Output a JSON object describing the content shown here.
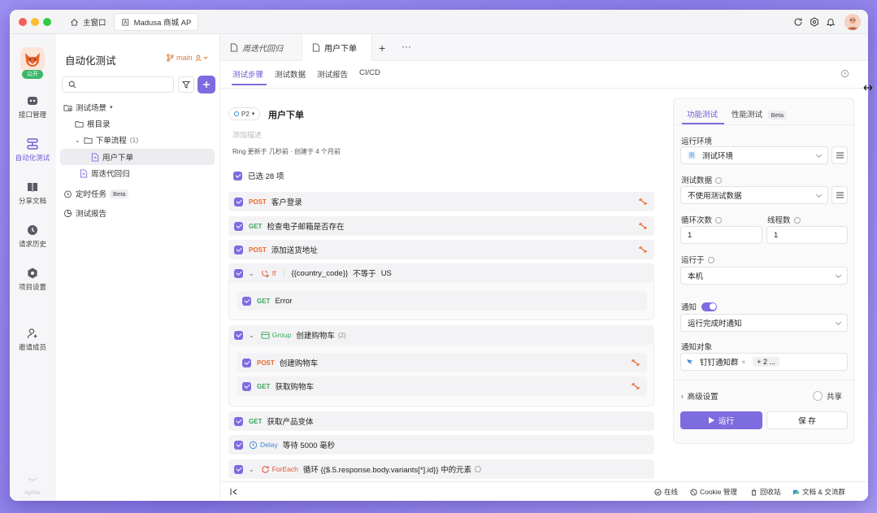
{
  "window": {
    "tabs": [
      {
        "label": "主窗口"
      },
      {
        "label": "Madusa 商城 API"
      }
    ]
  },
  "rail": {
    "team_badge": "公开",
    "items": [
      {
        "label": "接口管理",
        "icon": "api-icon"
      },
      {
        "label": "自动化测试",
        "icon": "automation-icon"
      },
      {
        "label": "分享文档",
        "icon": "book-icon"
      },
      {
        "label": "请求历史",
        "icon": "history-icon"
      },
      {
        "label": "项目设置",
        "icon": "settings-icon"
      },
      {
        "label": "邀请成员",
        "icon": "invite-user-icon"
      }
    ],
    "brand": "Apifox"
  },
  "tree": {
    "title": "自动化测试",
    "branch": "main",
    "search_placeholder": "",
    "rows": [
      {
        "label": "测试场景"
      },
      {
        "label": "根目录"
      },
      {
        "label": "下单流程",
        "count": "(1)"
      },
      {
        "label": "用户下单"
      },
      {
        "label": "周迭代回归"
      },
      {
        "label": "定时任务",
        "badge": "Beta"
      },
      {
        "label": "测试报告"
      }
    ]
  },
  "file_tabs": [
    {
      "label": "周迭代回归"
    },
    {
      "label": "用户下单"
    }
  ],
  "sub_tabs": [
    "测试步骤",
    "测试数据",
    "测试报告",
    "CI/CD"
  ],
  "scenario": {
    "priority": "P2",
    "name": "用户下单",
    "desc_placeholder": "添加描述",
    "meta": "Ring 更新于 几秒前 · 创建于 4 个月前",
    "selected_label": "已选 28 项"
  },
  "steps": [
    {
      "method": "POST",
      "name": "客户登录"
    },
    {
      "method": "GET",
      "name": "检查电子邮箱是否存在"
    },
    {
      "method": "POST",
      "name": "添加送货地址"
    },
    {
      "kind": "If",
      "left": "{{country_code}}",
      "op": "不等于",
      "right": "US"
    },
    {
      "method": "GET",
      "name": "Error"
    },
    {
      "kind": "Group",
      "name": "创建购物车",
      "count": "(2)"
    },
    {
      "method": "POST",
      "name": "创建购物车"
    },
    {
      "method": "GET",
      "name": "获取购物车"
    },
    {
      "method": "GET",
      "name": "获取产品变体"
    },
    {
      "kind": "Delay",
      "name": "等待 5000 毫秒"
    },
    {
      "kind": "ForEach",
      "name": "循环 {{$.5.response.body.variants[*].id}} 中的元素"
    }
  ],
  "panel": {
    "tabs": [
      "功能测试",
      "性能测试"
    ],
    "perf_badge": "Beta",
    "env_label": "运行环境",
    "env_value": "测试环境",
    "data_label": "测试数据",
    "data_value": "不使用测试数据",
    "loop_label": "循环次数",
    "loop_value": "1",
    "threads_label": "线程数",
    "threads_value": "1",
    "run_on_label": "运行于",
    "run_on_value": "本机",
    "notify_label": "通知",
    "notify_enabled": true,
    "notify_value": "运行完成时通知",
    "notify_target_label": "通知对象",
    "notify_target_tag": "钉钉通知群",
    "notify_more": "+ 2 ...",
    "advanced": "高级设置",
    "share": "共享",
    "run_button": "运行",
    "save_button": "保 存"
  },
  "statusbar": {
    "online": "在线",
    "cookie": "Cookie 管理",
    "trash": "回收站",
    "docs": "文档 & 交流群"
  },
  "colors": {
    "accent": "#7d6cdf",
    "post": "#e36a32",
    "get": "#3aa55c",
    "delay": "#3b8ad9",
    "foreach": "#e0542e",
    "group": "#3aa55c"
  }
}
